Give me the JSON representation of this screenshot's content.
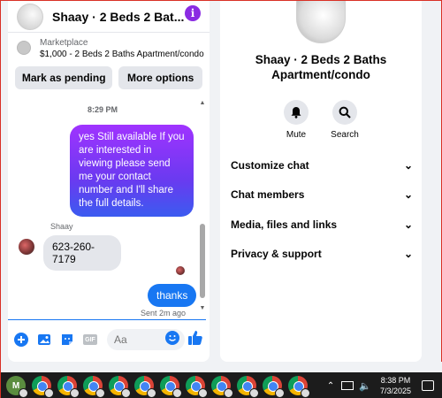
{
  "chat": {
    "title": "Shaay · 2 Beds 2 Bat...",
    "listing": {
      "source": "Marketplace",
      "description": "$1,000 - 2 Beds 2 Baths Apartment/condo"
    },
    "buttons": {
      "mark_pending": "Mark as pending",
      "more_options": "More options"
    },
    "timestamp": "8:29 PM",
    "messages": {
      "outgoing_1": "yes Still available If you are interested in viewing please send me your contact number and I'll share the full details.",
      "sender_name": "Shaay",
      "incoming_1": "623-260-7179",
      "outgoing_2": "thanks",
      "status": "Sent 2m ago"
    },
    "composer": {
      "placeholder": "Aa",
      "gif_label": "GIF"
    }
  },
  "info": {
    "title": "Shaay · 2 Beds 2 Baths Apartment/condo",
    "actions": {
      "mute": "Mute",
      "search": "Search"
    },
    "sections": [
      "Customize chat",
      "Chat members",
      "Media, files and links",
      "Privacy & support"
    ]
  },
  "taskbar": {
    "first_app_letter": "M",
    "time": "8:38 PM",
    "date": "7/3/2025"
  },
  "colors": {
    "accent": "#1877f2",
    "info_icon": "#8a2be2"
  }
}
